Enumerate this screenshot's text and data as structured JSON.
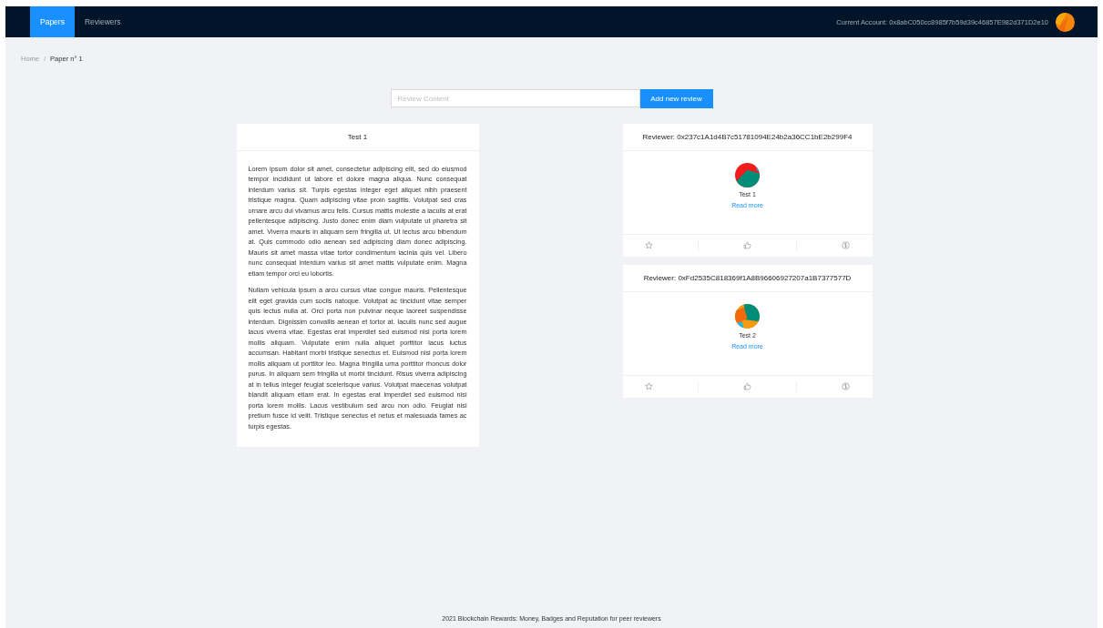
{
  "nav": {
    "tabs": [
      {
        "label": "Papers",
        "selected": true
      },
      {
        "label": "Reviewers",
        "selected": false
      }
    ],
    "account": "Current Account: 0x8abC050cc8985f7b59d39c46857E982d371D2e10"
  },
  "breadcrumb_separator": "/",
  "breadcrumb": [
    {
      "label": "Home",
      "current": false
    },
    {
      "label": "Paper n° 1",
      "current": true
    }
  ],
  "review_form": {
    "placeholder": "Review Content",
    "button": "Add new review"
  },
  "paper": {
    "title": "Test 1",
    "paragraphs": [
      "Lorem ipsum dolor sit amet, consectetur adipiscing elit, sed do eiusmod tempor incididunt ut labore et dolore magna aliqua. Nunc consequat interdum varius sit. Turpis egestas integer eget aliquet nibh praesent tristique magna. Quam adipiscing vitae proin sagittis. Volutpat sed cras ornare arcu dui vivamus arcu felis. Cursus mattis molestie a iaculis at erat pellentesque adipiscing. Justo donec enim diam vulputate ut pharetra sit amet. Viverra mauris in aliquam sem fringilla ut. Ut lectus arcu bibendum at. Quis commodo odio aenean sed adipiscing diam donec adipiscing. Mauris sit amet massa vitae tortor condimentum lacinia quis vel. Libero nunc consequat interdum varius sit amet mattis vulputate enim. Magna etiam tempor orci eu lobortis.",
      "Nullam vehicula ipsum a arcu cursus vitae congue mauris. Pellentesque elit eget gravida cum sociis natoque. Volutpat ac tincidunt vitae semper quis lectus nulla at. Orci porta non pulvinar neque laoreet suspendisse interdum. Dignissim convallis aenean et tortor at. Iaculis nunc sed augue lacus viverra vitae. Egestas erat imperdiet sed euismod nisi porta lorem mollis aliquam. Vulputate enim nulla aliquet porttitor lacus luctus accumsan. Habitant morbi tristique senectus et. Euismod nisi porta lorem mollis aliquam ut porttitor leo. Magna fringilla urna porttitor rhoncus dolor purus. In aliquam sem fringilla ut morbi tincidunt. Risus viverra adipiscing at in tellus integer feugiat scelerisque varius. Volutpat maecenas volutpat blandit aliquam etiam erat. In egestas erat imperdiet sed euismod nisi porta lorem mollis. Lacus vestibulum sed arcu non odio. Feugiat nisl pretium fusce id velit. Tristique senectus et netus et malesuada fames ac turpis egestas."
    ]
  },
  "reviews": [
    {
      "reviewer": "Reviewer: 0x237c1A1d4B7c51781094E24b2a36CC1bE2b299F4",
      "title": "Test 1",
      "link": "Read more"
    },
    {
      "reviewer": "Reviewer: 0xFd2535C818369f1A8B96606927207a1B7377577D",
      "title": "Test 2",
      "link": "Read more"
    }
  ],
  "footer": "2021 Blockchain Rewards: Money, Badges and Reputation for peer reviewers"
}
